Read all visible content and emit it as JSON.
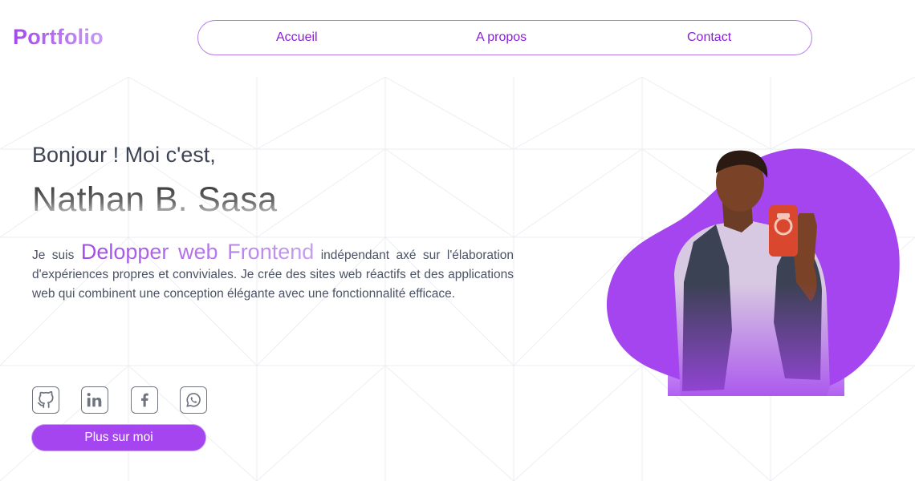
{
  "logo": "Portfolio",
  "nav": {
    "items": [
      {
        "label": "Accueil"
      },
      {
        "label": "A propos"
      },
      {
        "label": "Contact"
      }
    ]
  },
  "hero": {
    "greeting": "Bonjour ! Moi c'est,",
    "name": "Nathan B. Sasa",
    "bio_prefix": "Je suis ",
    "role": "Delopper web Frontend",
    "bio_suffix": " indépendant axé sur l'élaboration d'expériences propres et conviviales. Je crée des sites web réactifs et des applications web qui combinent une conception élégante avec une fonctionnalité efficace.",
    "cta_label": "Plus sur moi"
  },
  "social": [
    {
      "icon": "github-icon"
    },
    {
      "icon": "linkedin-icon"
    },
    {
      "icon": "facebook-icon"
    },
    {
      "icon": "whatsapp-icon"
    }
  ],
  "colors": {
    "accent": "#a445ef",
    "nav_text": "#8a1fd6",
    "text": "#4b5263",
    "blob": "#a445ef"
  }
}
